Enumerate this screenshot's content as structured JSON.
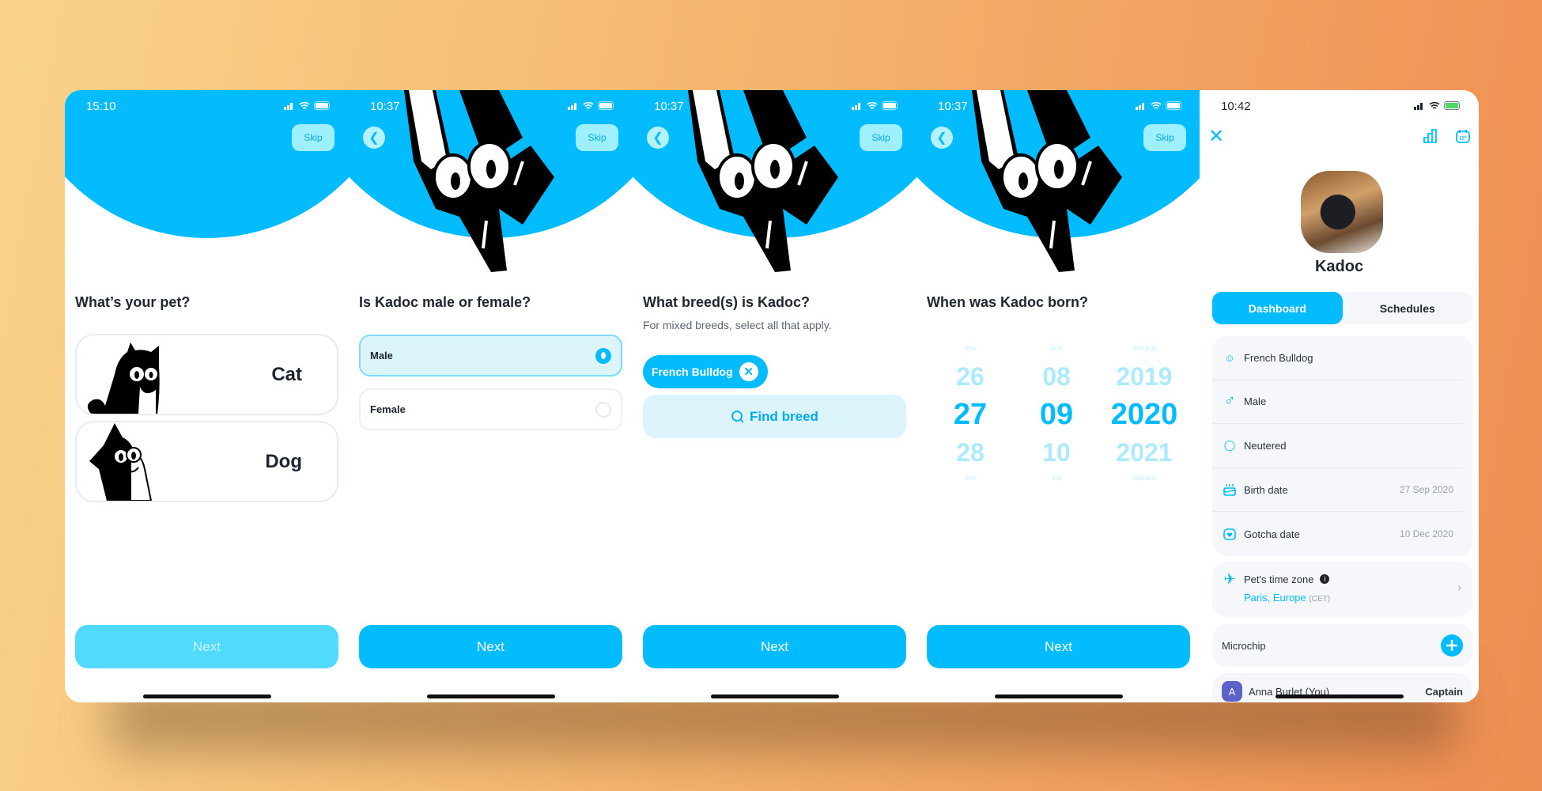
{
  "colors": {
    "accent": "#03BBFF",
    "accent_light": "#DCF5FD",
    "disabled": "#52DAFE"
  },
  "screens": [
    {
      "time": "15:10",
      "skip": "Skip",
      "question": "What’s your pet?",
      "options": [
        {
          "label": "Cat",
          "icon": "cat-illustration"
        },
        {
          "label": "Dog",
          "icon": "dog-illustration"
        }
      ],
      "next": "Next",
      "next_disabled": true
    },
    {
      "time": "10:37",
      "skip": "Skip",
      "question": "Is Kadoc male or female?",
      "options": [
        {
          "label": "Male",
          "selected": true
        },
        {
          "label": "Female",
          "selected": false
        }
      ],
      "next": "Next"
    },
    {
      "time": "10:37",
      "skip": "Skip",
      "question": "What breed(s) is Kadoc?",
      "subtitle": "For mixed breeds, select all that apply.",
      "chip": "French Bulldog",
      "find": "Find breed",
      "next": "Next"
    },
    {
      "time": "10:37",
      "skip": "Skip",
      "question": "When was Kadoc born?",
      "picker": {
        "day": [
          "25",
          "26",
          "27",
          "28",
          "29"
        ],
        "month": [
          "07",
          "08",
          "09",
          "10",
          "11"
        ],
        "year": [
          "2018",
          "2019",
          "2020",
          "2021",
          "2022"
        ],
        "selected": {
          "day": "27",
          "month": "09",
          "year": "2020"
        }
      },
      "next": "Next"
    }
  ],
  "profile": {
    "time": "10:42",
    "name": "Kadoc",
    "tabs": [
      "Dashboard",
      "Schedules"
    ],
    "active_tab": "Dashboard",
    "info": [
      {
        "icon": "dog-face-icon",
        "label": "French Bulldog",
        "value": ""
      },
      {
        "icon": "male-icon",
        "label": "Male",
        "value": ""
      },
      {
        "icon": "neutered-icon",
        "label": "Neutered",
        "value": ""
      },
      {
        "icon": "cake-icon",
        "label": "Birth date",
        "value": "27 Sep 2020"
      },
      {
        "icon": "calendar-heart-icon",
        "label": "Gotcha date",
        "value": "10 Dec 2020"
      }
    ],
    "timezone": {
      "label": "Pet's time zone",
      "city": "Paris, Europe",
      "abbr": "(CET)"
    },
    "microchip": "Microchip",
    "member": {
      "initial": "A",
      "name": "Anna Burlet (You)",
      "role": "Captain"
    }
  }
}
